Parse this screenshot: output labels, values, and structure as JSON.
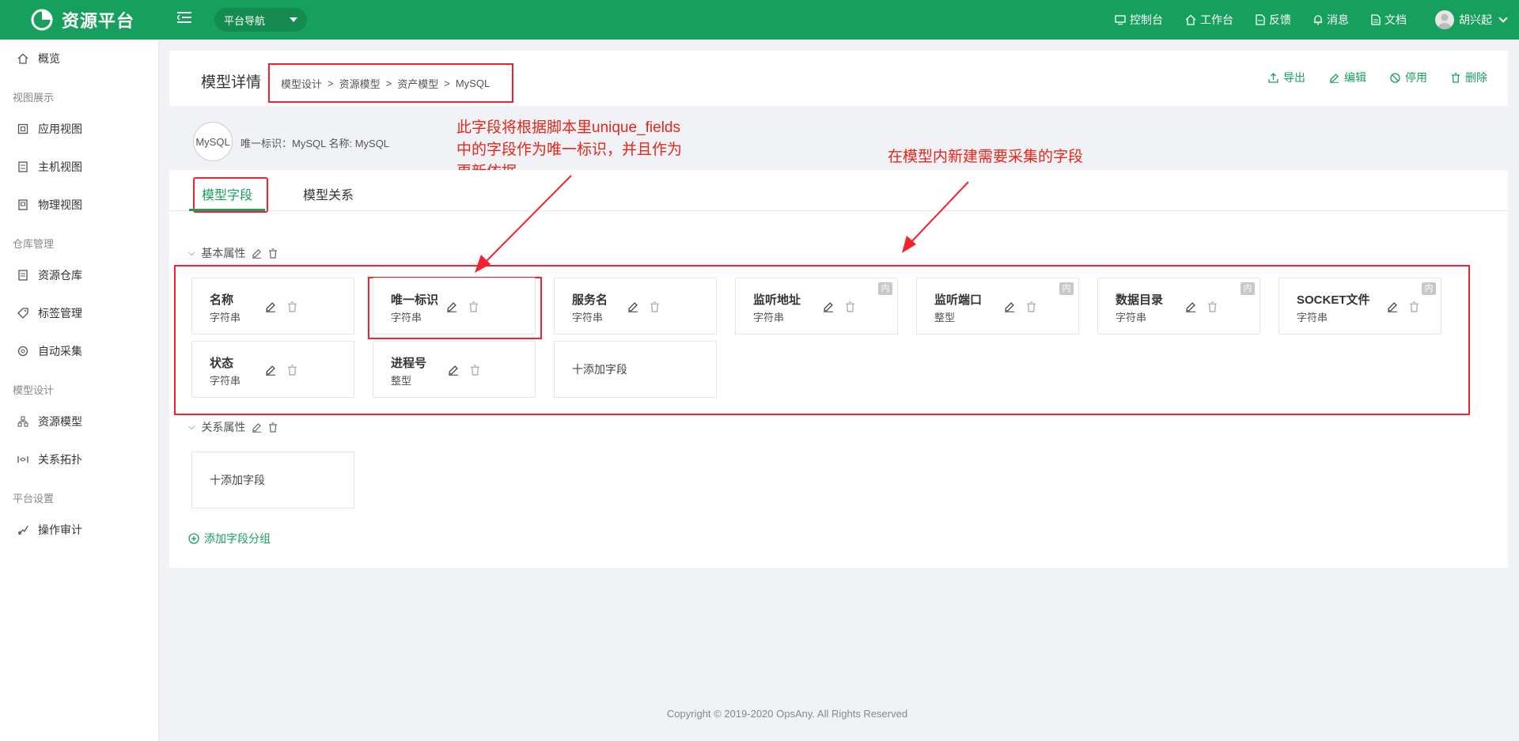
{
  "topbar": {
    "brand": "资源平台",
    "nav_select": "平台导航",
    "links": [
      "控制台",
      "工作台",
      "反馈",
      "消息",
      "文档"
    ],
    "user": "胡兴起",
    "bg_color": "#17a05d"
  },
  "sidebar": {
    "overview": "概览",
    "groups": {
      "view": "视图展示",
      "warehouse": "仓库管理",
      "model": "模型设计",
      "platform": "平台设置"
    },
    "items": {
      "app_view": "应用视图",
      "host_view": "主机视图",
      "physical_view": "物理视图",
      "resource_warehouse": "资源仓库",
      "tag_mgmt": "标签管理",
      "auto_collect": "自动采集",
      "resource_model": "资源模型",
      "relation_topo": "关系拓扑",
      "audit": "操作审计"
    }
  },
  "header": {
    "title": "模型详情",
    "breadcrumb": [
      "模型设计",
      "资源模型",
      "资产模型",
      "MySQL"
    ],
    "sep": ">",
    "actions": {
      "export": "导出",
      "edit": "编辑",
      "disable": "停用",
      "delete": "删除"
    }
  },
  "model": {
    "logo_text": "MySQL",
    "meta": "唯一标识：MySQL   名称: MySQL"
  },
  "annotations": {
    "unique_line1": "此字段将根据脚本里unique_fields",
    "unique_line2": "中的字段作为唯一标识，并且作为",
    "unique_line3": "更新依据",
    "new_fields": "在模型内新建需要采集的字段"
  },
  "tabs": {
    "fields": "模型字段",
    "relations": "模型关系"
  },
  "groups": {
    "basic": "基本属性",
    "relation": "关系属性",
    "add_group": "添加字段分组"
  },
  "fields": [
    {
      "name": "名称",
      "type": "字符串"
    },
    {
      "name": "唯一标识",
      "type": "字符串"
    },
    {
      "name": "服务名",
      "type": "字符串"
    },
    {
      "name": "监听地址",
      "type": "字符串",
      "badge": "内"
    },
    {
      "name": "监听端口",
      "type": "整型",
      "badge": "内"
    },
    {
      "name": "数据目录",
      "type": "字符串",
      "badge": "内"
    },
    {
      "name": "SOCKET文件",
      "type": "字符串",
      "badge": "内"
    },
    {
      "name": "状态",
      "type": "字符串"
    },
    {
      "name": "进程号",
      "type": "整型"
    }
  ],
  "add_field": "十添加字段",
  "footer": "Copyright © 2019-2020 OpsAny. All Rights Reserved",
  "colors": {
    "accent": "#17a05d",
    "annotation": "#f5222d"
  }
}
